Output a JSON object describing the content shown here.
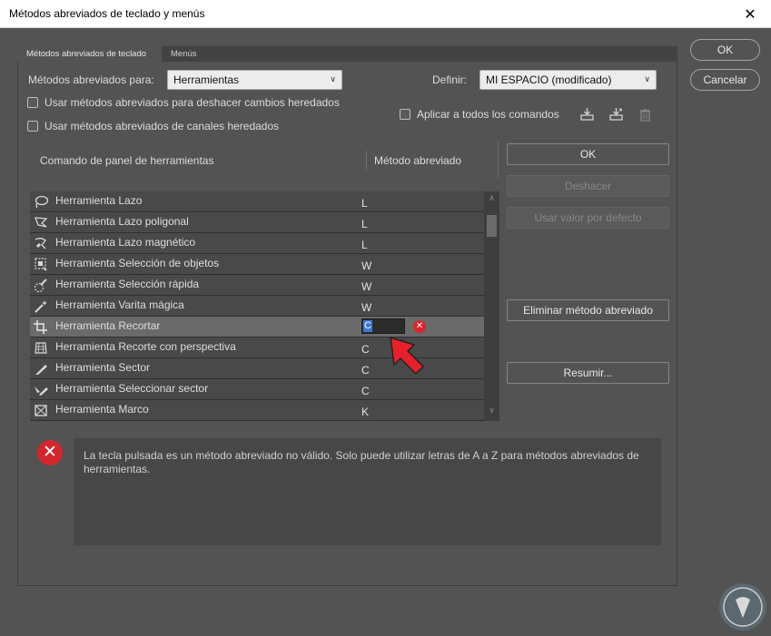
{
  "window": {
    "title": "Métodos abreviados de teclado y menús",
    "close_glyph": "✕"
  },
  "tabs": [
    {
      "label": "Métodos abreviados de teclado",
      "active": true
    },
    {
      "label": "Menús",
      "active": false
    }
  ],
  "shortcuts_for": {
    "label": "Métodos abreviados para:",
    "value": "Herramientas"
  },
  "set": {
    "label": "Definir:",
    "value": "MI ESPACIO (modificado)"
  },
  "checkboxes": {
    "undo_legacy": "Usar métodos abreviados para deshacer cambios heredados",
    "legacy_channel": "Usar métodos abreviados de canales heredados",
    "apply_all": "Aplicar a todos los comandos"
  },
  "icons": {
    "save": "save-set-icon",
    "save_as": "save-as-set-icon",
    "delete": "delete-set-icon"
  },
  "columns": {
    "command": "Comando de panel de herramientas",
    "shortcut": "Método abreviado"
  },
  "rows": [
    {
      "name": "Herramienta Lazo",
      "key": "L",
      "icon": "lasso-icon"
    },
    {
      "name": "Herramienta Lazo poligonal",
      "key": "L",
      "icon": "polygonal-lasso-icon"
    },
    {
      "name": "Herramienta Lazo magnético",
      "key": "L",
      "icon": "magnetic-lasso-icon"
    },
    {
      "name": "Herramienta Selección de objetos",
      "key": "W",
      "icon": "object-selection-icon"
    },
    {
      "name": "Herramienta Selección rápida",
      "key": "W",
      "icon": "quick-selection-icon"
    },
    {
      "name": "Herramienta Varita mágica",
      "key": "W",
      "icon": "magic-wand-icon"
    },
    {
      "name": "Herramienta Recortar",
      "key": "C",
      "icon": "crop-icon",
      "selected": true
    },
    {
      "name": "Herramienta Recorte con perspectiva",
      "key": "C",
      "icon": "perspective-crop-icon"
    },
    {
      "name": "Herramienta Sector",
      "key": "C",
      "icon": "slice-icon"
    },
    {
      "name": "Herramienta Seleccionar sector",
      "key": "C",
      "icon": "slice-select-icon"
    },
    {
      "name": "Herramienta Marco",
      "key": "K",
      "icon": "frame-icon"
    }
  ],
  "buttons": {
    "ok_main": "OK",
    "cancel": "Cancelar",
    "ok": "OK",
    "undo": "Deshacer",
    "use_default": "Usar valor por defecto",
    "delete_shortcut": "Eliminar método abreviado",
    "summarize": "Resumir..."
  },
  "message": "La tecla pulsada es un método abreviado no válido. Solo puede utilizar letras de A a Z para métodos abreviados de herramientas.",
  "colors": {
    "panel": "#535353",
    "error": "#d6262d",
    "arrow": "#e8202a",
    "selection": "#3b77d5"
  }
}
